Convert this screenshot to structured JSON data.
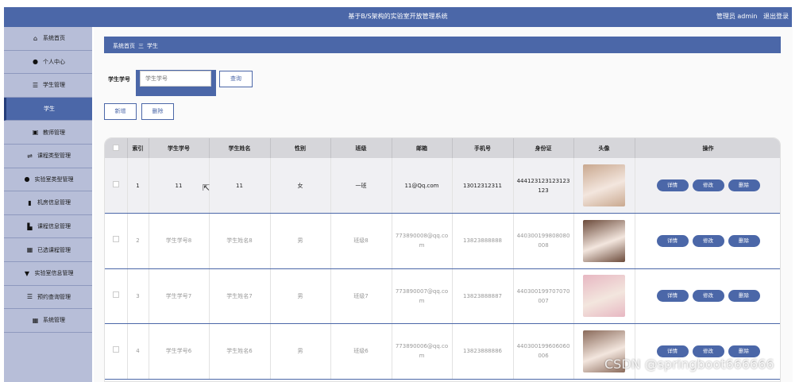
{
  "header": {
    "title": "基于B/S架构的实验室开放管理系统",
    "user_label": "管理员 admin",
    "logout_label": "退出登录"
  },
  "sidebar": {
    "items": [
      {
        "label": "系统首页",
        "icon": "home-icon",
        "glyph": "⌂"
      },
      {
        "label": "个人中心",
        "icon": "user-icon",
        "glyph": "●"
      },
      {
        "label": "学生管理",
        "icon": "list-icon",
        "glyph": "☰"
      },
      {
        "label": "学生",
        "icon": "",
        "glyph": "",
        "active": true
      },
      {
        "label": "教师管理",
        "icon": "chart-icon",
        "glyph": "▣"
      },
      {
        "label": "课程类型管理",
        "icon": "sliders-icon",
        "glyph": "⇌"
      },
      {
        "label": "实验室类型管理",
        "icon": "user-icon",
        "glyph": "●"
      },
      {
        "label": "机房信息管理",
        "icon": "bar-chart-icon",
        "glyph": "▮"
      },
      {
        "label": "课程信息管理",
        "icon": "book-icon",
        "glyph": "▙"
      },
      {
        "label": "已选课程管理",
        "icon": "grid-icon",
        "glyph": "▦"
      },
      {
        "label": "实验室信息管理",
        "icon": "filter-icon",
        "glyph": "▼"
      },
      {
        "label": "预约查询管理",
        "icon": "list-icon",
        "glyph": "☰"
      },
      {
        "label": "系统管理",
        "icon": "grid-icon",
        "glyph": "▦"
      }
    ]
  },
  "breadcrumb": {
    "home": "系统首页",
    "separator": "三",
    "current": "学生"
  },
  "search": {
    "label": "学生学号",
    "placeholder": "学生学号",
    "button": "查询"
  },
  "actions": {
    "add": "新增",
    "delete": "删除"
  },
  "table": {
    "headers": [
      "索引",
      "学生学号",
      "学生姓名",
      "性别",
      "班级",
      "邮箱",
      "手机号",
      "身份证",
      "头像",
      "操作"
    ],
    "rows": [
      {
        "index": "1",
        "student_no": "11",
        "name": "11",
        "gender": "女",
        "class": "一班",
        "email": "11@Qq.com",
        "phone": "13012312311",
        "id_card": "444123123123123123",
        "avatar_color": "#c9a88f"
      },
      {
        "index": "2",
        "student_no": "学生学号8",
        "name": "学生姓名8",
        "gender": "男",
        "class": "班级8",
        "email": "773890008@qq.com",
        "phone": "13823888888",
        "id_card": "440300199808080008",
        "avatar_color": "#6b4a3a"
      },
      {
        "index": "3",
        "student_no": "学生学号7",
        "name": "学生姓名7",
        "gender": "男",
        "class": "班级7",
        "email": "773890007@qq.com",
        "phone": "13823888887",
        "id_card": "440300199707070007",
        "avatar_color": "#e7b7c2"
      },
      {
        "index": "4",
        "student_no": "学生学号6",
        "name": "学生姓名6",
        "gender": "男",
        "class": "班级6",
        "email": "773890006@qq.com",
        "phone": "13823888886",
        "id_card": "440300199606060006",
        "avatar_color": "#8a6a5a"
      }
    ],
    "row_actions": {
      "detail": "详情",
      "edit": "修改",
      "delete": "删除"
    }
  },
  "watermark": "CSDN @springboot666666",
  "colors": {
    "primary": "#4b67a8",
    "sidebar": "#b7bed8"
  }
}
